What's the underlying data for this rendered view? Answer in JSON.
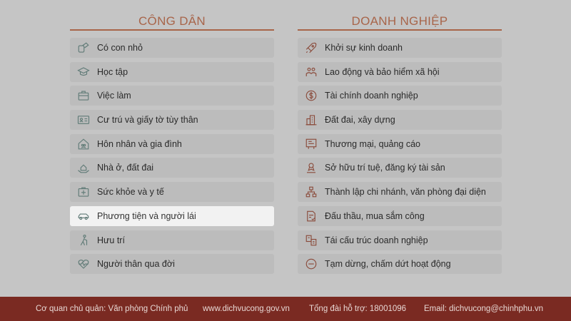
{
  "citizen": {
    "title": "CÔNG DÂN",
    "items": [
      {
        "label": "Có con nhỏ",
        "icon": "baby-icon"
      },
      {
        "label": "Học tập",
        "icon": "graduation-cap-icon"
      },
      {
        "label": "Việc làm",
        "icon": "briefcase-icon"
      },
      {
        "label": "Cư trú và giấy tờ tùy thân",
        "icon": "id-card-icon"
      },
      {
        "label": "Hôn nhân và gia đình",
        "icon": "family-home-icon"
      },
      {
        "label": "Nhà ở, đất đai",
        "icon": "house-land-icon"
      },
      {
        "label": "Sức khỏe và y tế",
        "icon": "medical-kit-icon"
      },
      {
        "label": "Phương tiện và người lái",
        "icon": "car-icon"
      },
      {
        "label": "Hưu trí",
        "icon": "elderly-icon"
      },
      {
        "label": "Người thân qua đời",
        "icon": "heart-pulse-icon"
      }
    ],
    "active_index": 7
  },
  "business": {
    "title": "DOANH NGHIỆP",
    "items": [
      {
        "label": "Khởi sự kinh doanh",
        "icon": "rocket-icon"
      },
      {
        "label": "Lao động và bảo hiểm xã hội",
        "icon": "workers-icon"
      },
      {
        "label": "Tài chính doanh nghiệp",
        "icon": "dollar-icon"
      },
      {
        "label": "Đất đai, xây dựng",
        "icon": "building-icon"
      },
      {
        "label": "Thương mại, quảng cáo",
        "icon": "billboard-icon"
      },
      {
        "label": "Sở hữu trí tuệ, đăng ký tài sản",
        "icon": "certificate-icon"
      },
      {
        "label": "Thành lập chi nhánh, văn phòng đại diện",
        "icon": "org-chart-icon"
      },
      {
        "label": "Đấu thầu, mua sắm công",
        "icon": "document-check-icon"
      },
      {
        "label": "Tái cấu trúc doanh nghiệp",
        "icon": "restructure-icon"
      },
      {
        "label": "Tạm dừng, chấm dứt hoạt động",
        "icon": "minus-circle-icon"
      }
    ]
  },
  "footer": {
    "agency": "Cơ quan chủ quản: Văn phòng Chính phủ",
    "website": "www.dichvucong.gov.vn",
    "hotline": "Tổng đài hỗ trợ: 18001096",
    "email": "Email: dichvucong@chinhphu.vn"
  },
  "colors": {
    "accent": "#a8654a",
    "footer_bg": "#7a2a22",
    "page_bg": "#c5c5c5",
    "item_bg": "#bcbcbc",
    "active_bg": "#f2f2f2"
  }
}
